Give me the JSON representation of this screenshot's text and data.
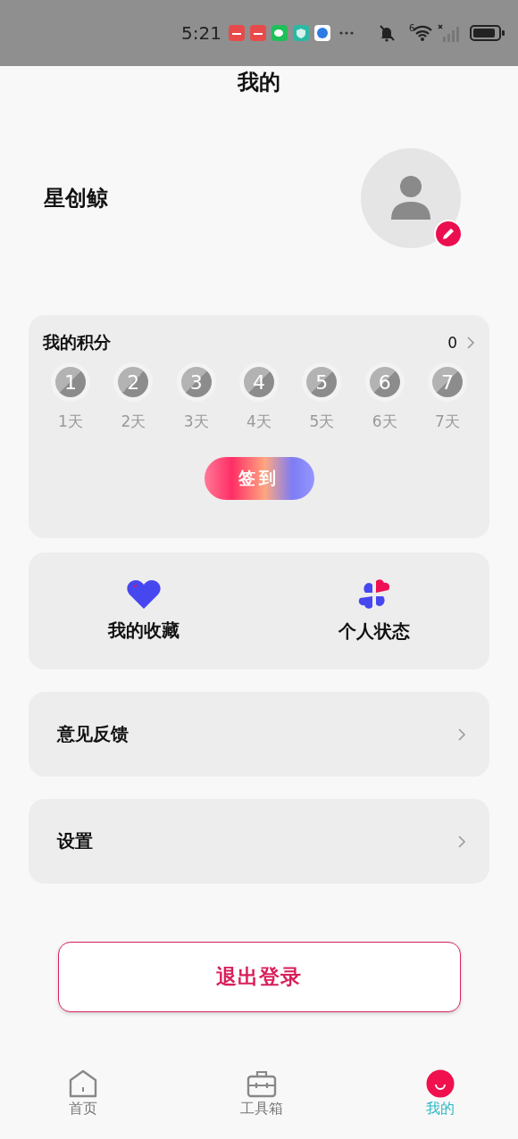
{
  "status_bar": {
    "time": "5:21",
    "wifi_label": "6"
  },
  "header": {
    "title": "我的"
  },
  "profile": {
    "name": "星创鲸"
  },
  "points": {
    "title": "我的积分",
    "value": "0",
    "days": [
      {
        "number": "1",
        "label": "1天"
      },
      {
        "number": "2",
        "label": "2天"
      },
      {
        "number": "3",
        "label": "3天"
      },
      {
        "number": "4",
        "label": "4天"
      },
      {
        "number": "5",
        "label": "5天"
      },
      {
        "number": "6",
        "label": "6天"
      },
      {
        "number": "7",
        "label": "7天"
      }
    ],
    "checkin_button": "签到"
  },
  "shortcuts": [
    {
      "kind": "heart",
      "label": "我的收藏"
    },
    {
      "kind": "clover",
      "label": "个人状态"
    }
  ],
  "menu": [
    {
      "label": "意见反馈"
    },
    {
      "label": "设置"
    }
  ],
  "logout_button": "退出登录",
  "tab_bar": [
    {
      "kind": "home",
      "label": "首页",
      "selected": false
    },
    {
      "kind": "toolbox",
      "label": "工具箱",
      "selected": false
    },
    {
      "kind": "me",
      "label": "我的",
      "selected": true
    }
  ]
}
